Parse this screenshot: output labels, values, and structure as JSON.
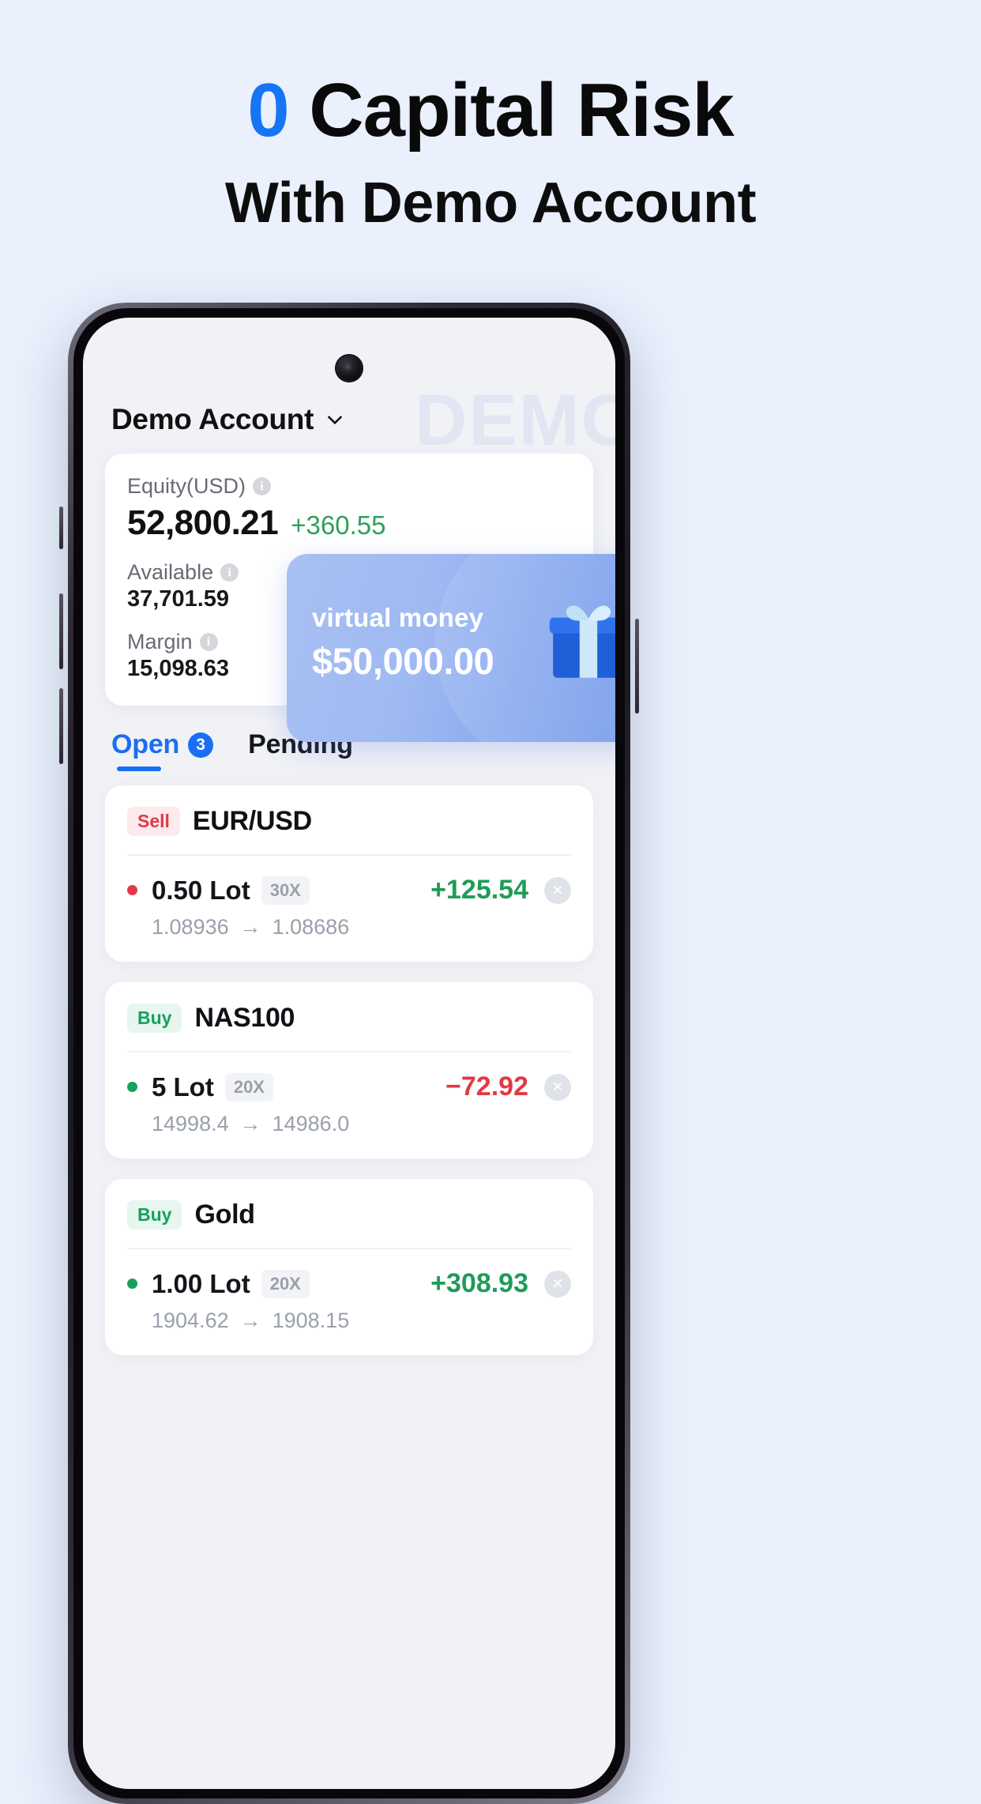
{
  "promo": {
    "headline_zero": "0",
    "headline_rest": " Capital Risk",
    "subheadline": "With Demo Account",
    "accent_color": "#1575f4"
  },
  "app": {
    "account": {
      "name": "Demo Account",
      "chevron_icon": "chevron-down-icon",
      "watermark": "DEMO"
    },
    "equity_card": {
      "equity_label": "Equity(USD)",
      "equity_value": "52,800.21",
      "equity_change": "+360.55",
      "equity_change_color": "#2f9e5c",
      "available_label": "Available",
      "available_value": "37,701.59",
      "margin_label": "Margin",
      "margin_value": "15,098.63",
      "info_icon": "info-icon"
    },
    "gift_banner": {
      "title": "virtual money",
      "amount": "$50,000.00",
      "icon": "gift-icon"
    },
    "tabs": [
      {
        "label": "Open",
        "badge": "3",
        "active": true
      },
      {
        "label": "Pending",
        "badge": "",
        "active": false
      }
    ],
    "trades": [
      {
        "side": "Sell",
        "symbol": "EUR/USD",
        "lot": "0.50 Lot",
        "leverage": "30X",
        "pnl": "+125.54",
        "pnl_sign": "positive",
        "open_price": "1.08936",
        "current_price": "1.08686",
        "arrow": "→",
        "close_icon": "close-circle-icon"
      },
      {
        "side": "Buy",
        "symbol": "NAS100",
        "lot": "5 Lot",
        "leverage": "20X",
        "pnl": "−72.92",
        "pnl_sign": "negative",
        "open_price": "14998.4",
        "current_price": "14986.0",
        "arrow": "→",
        "close_icon": "close-circle-icon"
      },
      {
        "side": "Buy",
        "symbol": "Gold",
        "lot": "1.00 Lot",
        "leverage": "20X",
        "pnl": "+308.93",
        "pnl_sign": "positive",
        "open_price": "1904.62",
        "current_price": "1908.15",
        "arrow": "→",
        "close_icon": "close-circle-icon"
      }
    ]
  }
}
